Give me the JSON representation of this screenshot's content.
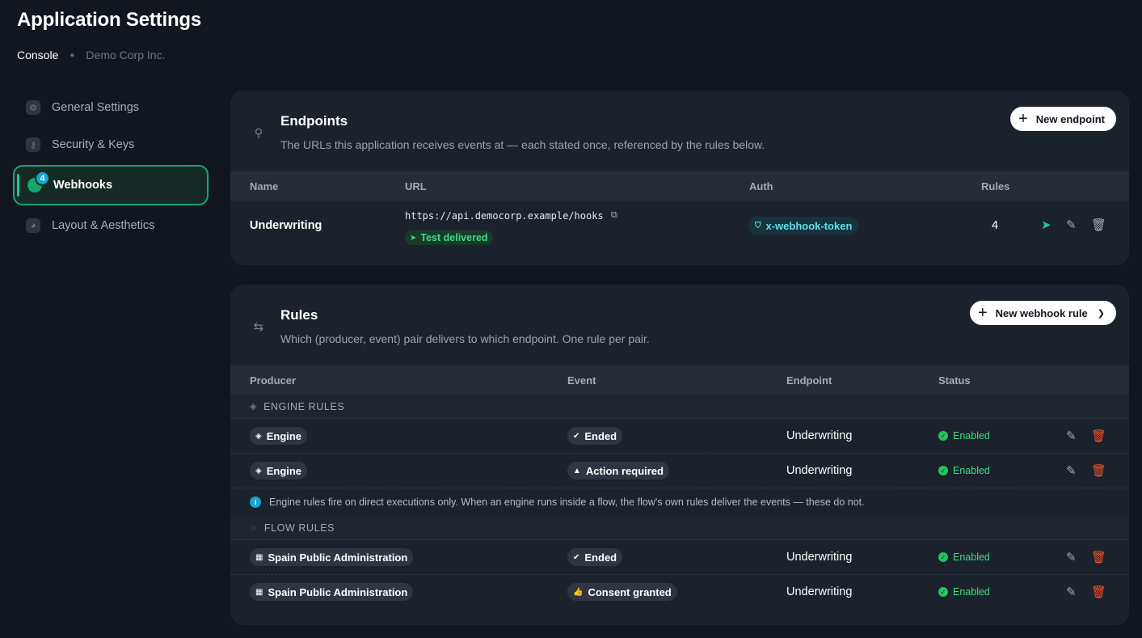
{
  "header": {
    "title": "Application Settings",
    "breadcrumb": [
      "Console",
      "Demo Corp Inc."
    ]
  },
  "sidebar": {
    "items": [
      {
        "label": "General Settings",
        "icon": "gear-icon"
      },
      {
        "label": "Security & Keys",
        "icon": "key-icon"
      },
      {
        "label": "Webhooks",
        "icon": "webhook-icon",
        "badge": "4",
        "active": true
      },
      {
        "label": "Layout & Aesthetics",
        "icon": "palette-icon"
      }
    ]
  },
  "endpoints": {
    "title": "Endpoints",
    "subtitle": "The URLs this application receives events at — each stated once, referenced by the rules below.",
    "new_button": "New endpoint",
    "columns": [
      "Name",
      "URL",
      "Auth",
      "Rules"
    ],
    "rows": [
      {
        "name": "Underwriting",
        "url": "https://api.democorp.example/hooks",
        "test_status": "Test delivered",
        "auth": "x-webhook-token",
        "rules": "4"
      }
    ]
  },
  "rules": {
    "title": "Rules",
    "subtitle": "Which (producer, event) pair delivers to which endpoint. One rule per pair.",
    "new_button": "New webhook rule",
    "columns": [
      "Producer",
      "Event",
      "Endpoint",
      "Status"
    ],
    "groups": [
      {
        "label": "ENGINE RULES",
        "rows": [
          {
            "producer": "Engine",
            "event": "Ended",
            "endpoint": "Underwriting",
            "status": "Enabled"
          },
          {
            "producer": "Engine",
            "event": "Action required",
            "endpoint": "Underwriting",
            "status": "Enabled"
          }
        ],
        "note": "Engine rules fire on direct executions only. When an engine runs inside a flow, the flow's own rules deliver the events — these do not."
      },
      {
        "label": "FLOW RULES",
        "rows": [
          {
            "producer": "Spain Public Administration",
            "event": "Ended",
            "endpoint": "Underwriting",
            "status": "Enabled"
          },
          {
            "producer": "Spain Public Administration",
            "event": "Consent granted",
            "endpoint": "Underwriting",
            "status": "Enabled"
          }
        ]
      }
    ]
  },
  "colors": {
    "accent": "#22c58f",
    "enabled": "#3ddc84",
    "delete": "#f4512c",
    "info": "#1aa4ce"
  }
}
